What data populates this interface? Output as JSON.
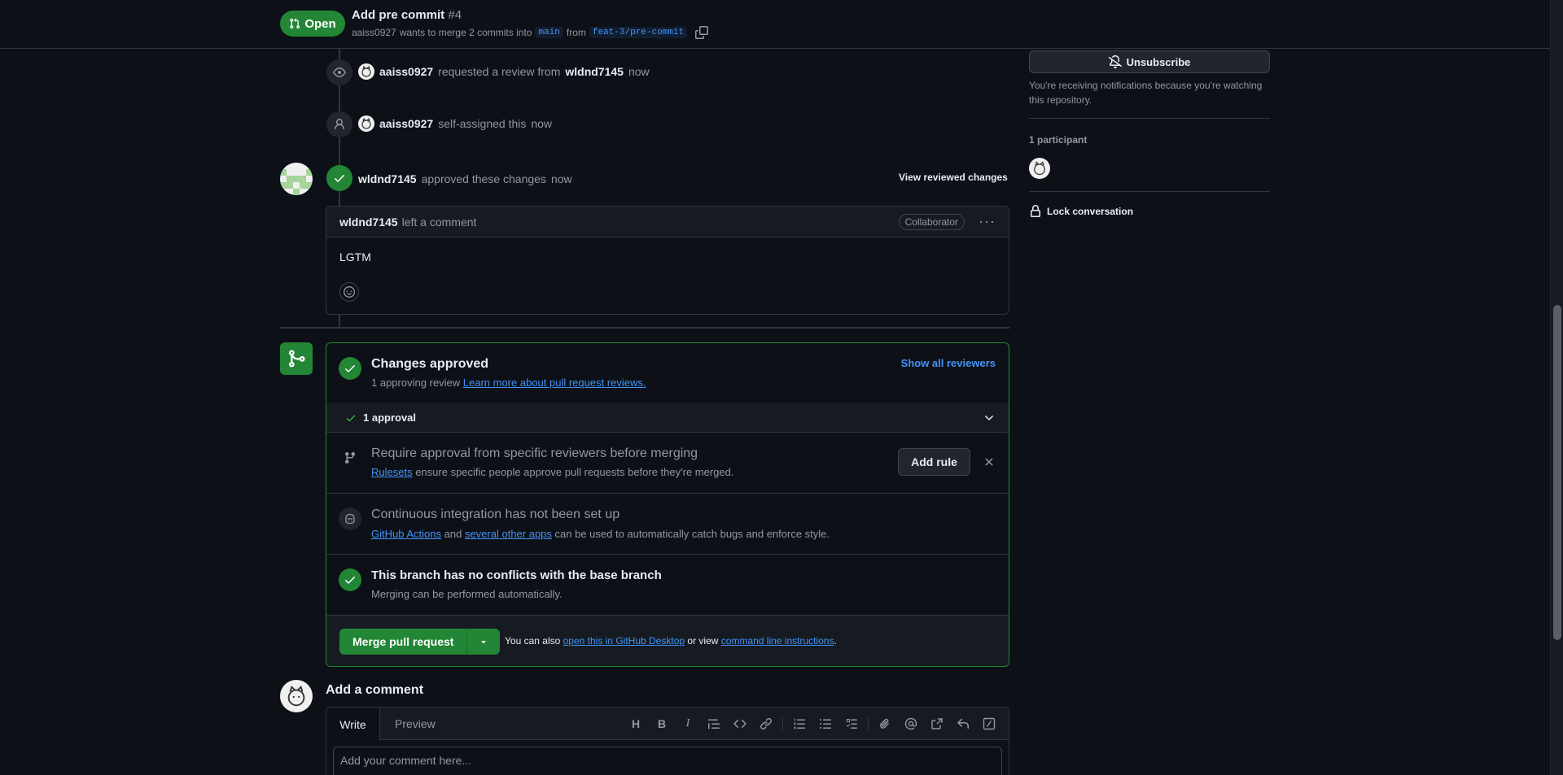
{
  "header": {
    "state": "Open",
    "title": "Add pre commit",
    "number": "#4",
    "author": "aaiss0927",
    "merge_text": "wants to merge 2 commits into",
    "base_branch": "main",
    "from_text": "from",
    "head_branch": "feat-3/pre-commit"
  },
  "timeline": {
    "event1": {
      "actor": "aaiss0927",
      "action": "requested a review from",
      "target": "wldnd7145",
      "time": "now"
    },
    "event2": {
      "actor": "aaiss0927",
      "action": "self-assigned this",
      "time": "now"
    },
    "review": {
      "actor": "wldnd7145",
      "action": "approved these changes",
      "time": "now",
      "view_link": "View reviewed changes",
      "comment_author": "wldnd7145",
      "comment_action": "left a comment",
      "role": "Collaborator",
      "body": "LGTM"
    }
  },
  "merge_box": {
    "approved_title": "Changes approved",
    "approving_count": "1 approving review",
    "learn_more": "Learn more about pull request reviews.",
    "show_reviewers": "Show all reviewers",
    "approvals": "1 approval",
    "require_title": "Require approval from specific reviewers before merging",
    "rulesets_link": "Rulesets",
    "rulesets_desc": "ensure specific people approve pull requests before they're merged.",
    "add_rule": "Add rule",
    "ci_title": "Continuous integration has not been set up",
    "ci_link1": "GitHub Actions",
    "ci_and": "and",
    "ci_link2": "several other apps",
    "ci_desc": "can be used to automatically catch bugs and enforce style.",
    "conflict_title": "This branch has no conflicts with the base branch",
    "conflict_desc": "Merging can be performed automatically.",
    "merge_button": "Merge pull request",
    "also_text": "You can also",
    "desktop_link": "open this in GitHub Desktop",
    "or_view": "or view",
    "cli_link": "command line instructions",
    "period": "."
  },
  "add_comment": {
    "title": "Add a comment",
    "tab_write": "Write",
    "tab_preview": "Preview",
    "placeholder": "Add your comment here..."
  },
  "sidebar": {
    "unsubscribe": "Unsubscribe",
    "note": "You're receiving notifications because you're watching this repository.",
    "participants": "1 participant",
    "lock": "Lock conversation"
  },
  "colors": {
    "accent_green": "#238636",
    "link_blue": "#4493f8",
    "background": "#0d1117"
  }
}
